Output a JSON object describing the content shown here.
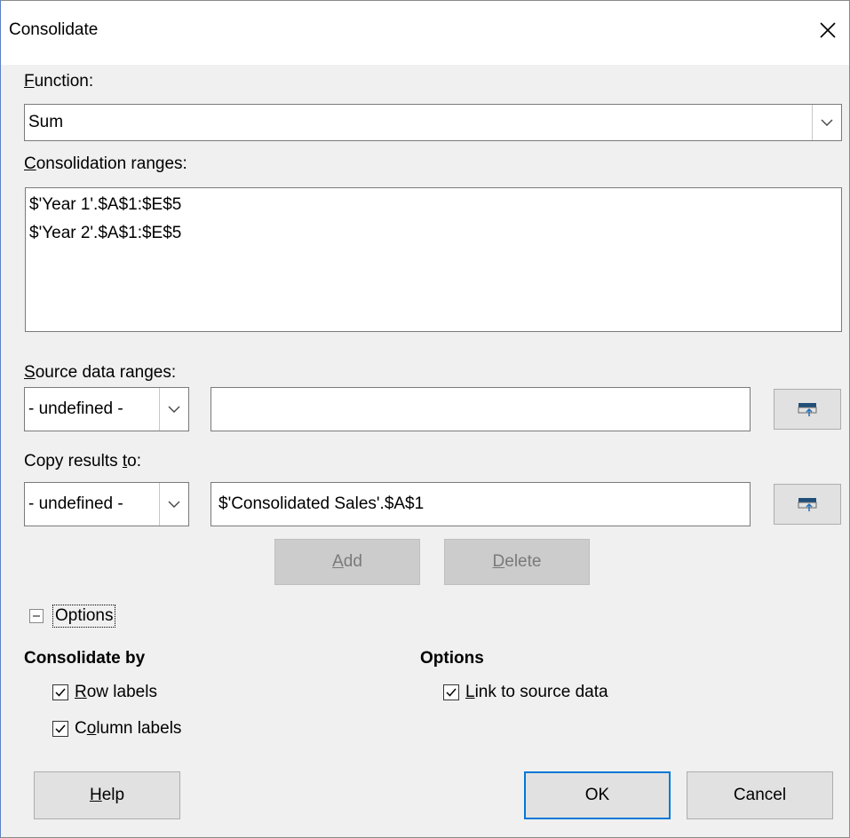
{
  "window": {
    "title": "Consolidate",
    "close_icon": "close-icon"
  },
  "function": {
    "label_mn": "F",
    "label_rest": "unction:",
    "value": "Sum"
  },
  "consolidation": {
    "label_mn": "C",
    "label_rest": "onsolidation ranges:",
    "ranges": [
      "$'Year 1'.$A$1:$E$5",
      "$'Year 2'.$A$1:$E$5"
    ]
  },
  "source": {
    "label_mn": "S",
    "label_rest": "ource data ranges:",
    "named_range": "- undefined -",
    "value": ""
  },
  "copy": {
    "label_pre": "Copy results ",
    "label_mn": "t",
    "label_rest": "o:",
    "named_range": "- undefined -",
    "value": "$'Consolidated Sales'.$A$1"
  },
  "buttons": {
    "add_mn": "A",
    "add_rest": "dd",
    "delete_mn": "D",
    "delete_rest": "elete",
    "help_mn": "H",
    "help_rest": "elp",
    "ok": "OK",
    "cancel": "Cancel"
  },
  "options": {
    "expander_label": "Options",
    "consolidate_by_heading": "Consolidate by",
    "row_labels_mn": "R",
    "row_labels_rest": "ow labels",
    "row_labels_checked": true,
    "column_labels_pre": "C",
    "column_labels_mn": "o",
    "column_labels_rest": "lumn labels",
    "column_labels_checked": true,
    "options_heading": "Options",
    "link_mn": "L",
    "link_rest": "ink to source data",
    "link_checked": true
  }
}
